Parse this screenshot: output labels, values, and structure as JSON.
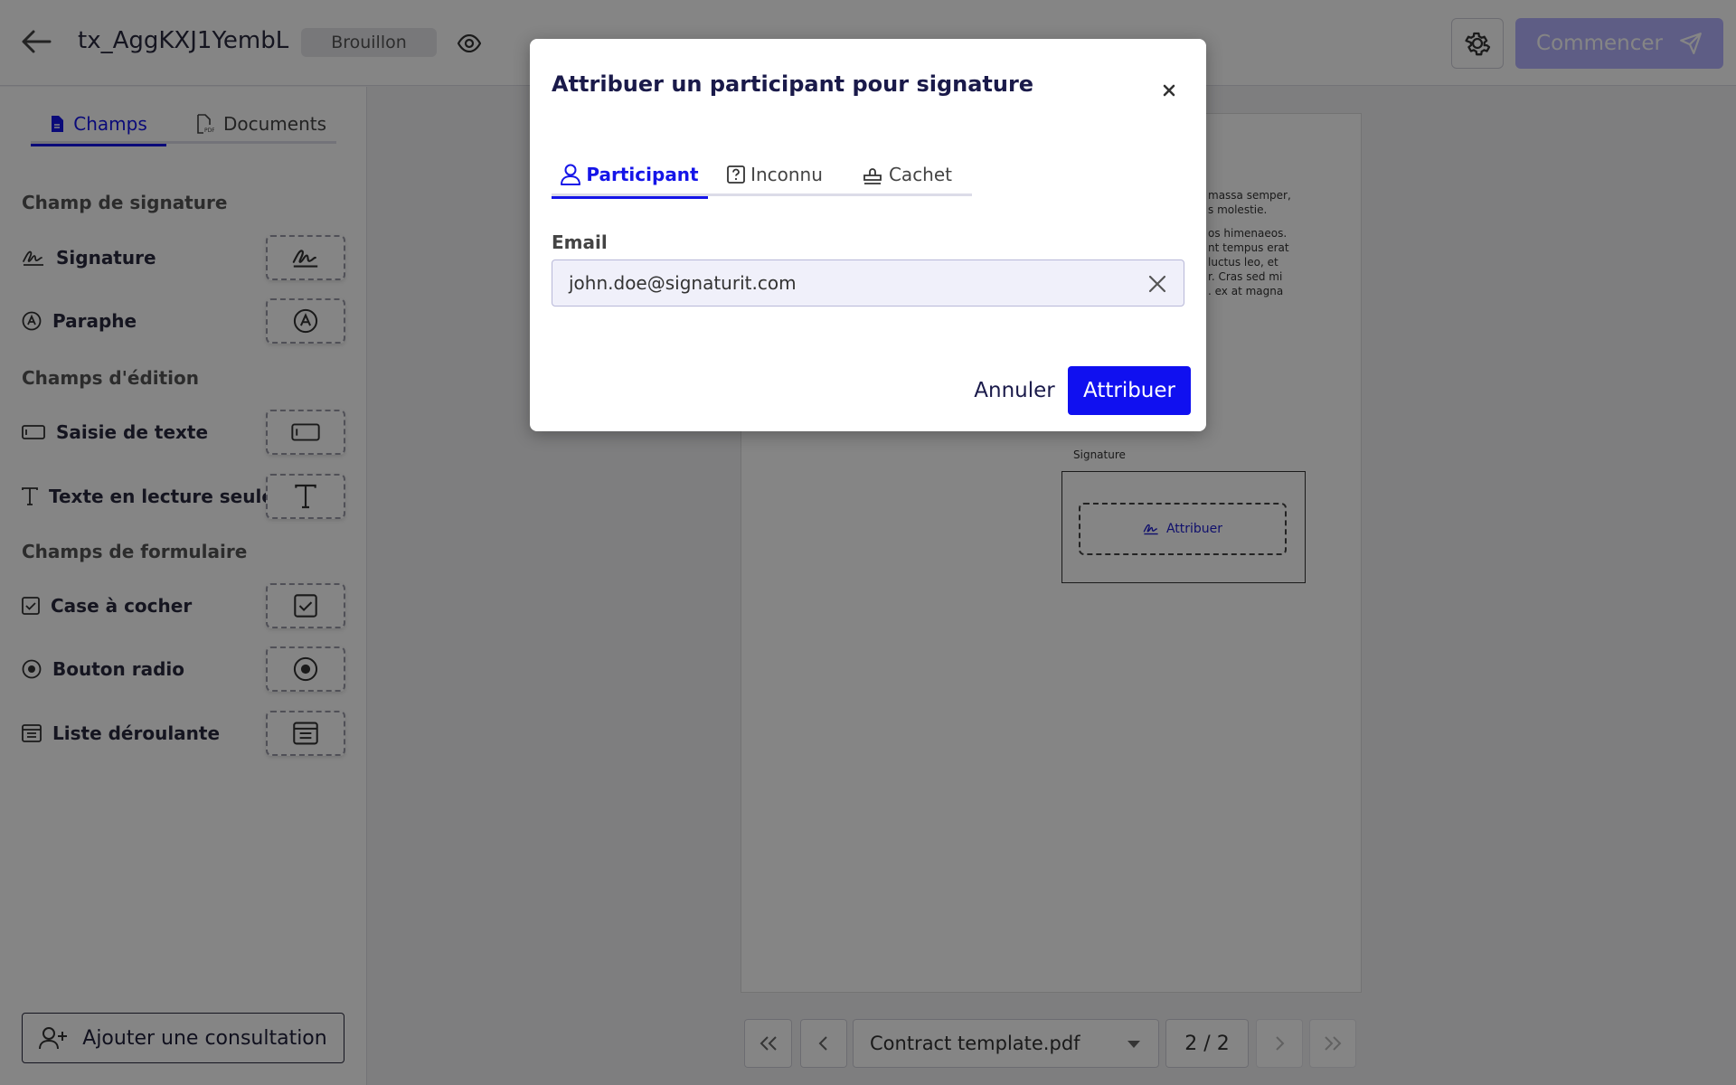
{
  "header": {
    "title": "tx_AggKXJ1YembL",
    "status": "Brouillon",
    "start_label": "Commencer"
  },
  "sidebar": {
    "tabs": [
      {
        "label": "Champs",
        "active": true
      },
      {
        "label": "Documents",
        "active": false
      }
    ],
    "sections": {
      "signature": "Champ de signature",
      "edit": "Champs d'édition",
      "form": "Champs de formulaire"
    },
    "fields": {
      "signature": "Signature",
      "initials": "Paraphe",
      "text_input": "Saisie de texte",
      "readonly_text": "Texte en lecture seule",
      "checkbox": "Case à cocher",
      "radio": "Bouton radio",
      "dropdown": "Liste déroulante"
    },
    "add_consultation": "Ajouter une consultation"
  },
  "document": {
    "text_lines_1": [
      "massa semper,",
      "s molestie."
    ],
    "text_lines_2": [
      "os himenaeos.",
      "nt tempus erat",
      "luctus leo, et",
      "r. Cras sed mi",
      ". ex at magna"
    ],
    "signature_label": "Signature",
    "signature_assign": "Attribuer"
  },
  "pagination": {
    "document_name": "Contract template.pdf",
    "page_counter": "2 / 2"
  },
  "modal": {
    "title": "Attribuer un participant pour signature",
    "tabs": [
      {
        "label": "Participant",
        "active": true
      },
      {
        "label": "Inconnu",
        "active": false
      },
      {
        "label": "Cachet",
        "active": false
      }
    ],
    "email_label": "Email",
    "email_value": "john.doe@signaturit.com",
    "cancel_label": "Annuler",
    "assign_label": "Attribuer"
  },
  "colors": {
    "accent": "#1010f0",
    "start_button": "#b5b2ff"
  }
}
